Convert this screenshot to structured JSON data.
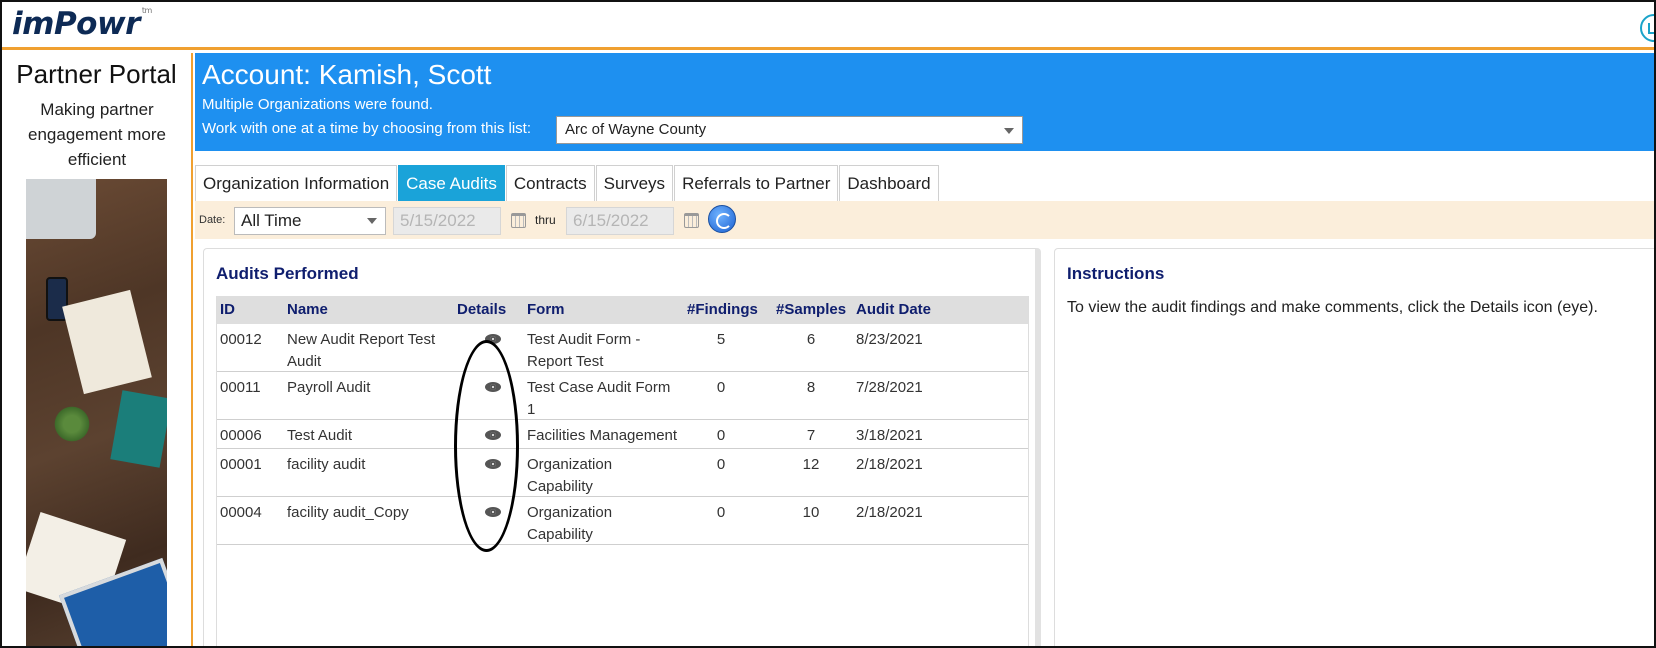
{
  "app": {
    "logo_prefix": "im",
    "logo_suffix": "Powr",
    "logo_tm": "tm"
  },
  "sidebar": {
    "title": "Partner Portal",
    "subtitle": "Making partner engagement more efficient"
  },
  "account": {
    "title": "Account: Kamish, Scott",
    "line1": "Multiple Organizations were found.",
    "line2": "Work with one at a time by choosing from this list:",
    "selected_org": "Arc of Wayne County"
  },
  "tabs": [
    {
      "label": "Organization Information",
      "active": false
    },
    {
      "label": "Case Audits",
      "active": true
    },
    {
      "label": "Contracts",
      "active": false
    },
    {
      "label": "Surveys",
      "active": false
    },
    {
      "label": "Referrals to Partner",
      "active": false
    },
    {
      "label": "Dashboard",
      "active": false
    }
  ],
  "date_filter": {
    "label": "Date:",
    "range": "All Time",
    "from_placeholder": "5/15/2022",
    "thru_label": "thru",
    "to_placeholder": "6/15/2022"
  },
  "audits": {
    "title": "Audits Performed",
    "columns": [
      "ID",
      "Name",
      "Details",
      "Form",
      "#Findings",
      "#Samples",
      "Audit Date"
    ],
    "rows": [
      {
        "id": "00012",
        "name": "New Audit Report Test Audit",
        "form": "Test Audit Form - Report Test",
        "findings": "5",
        "samples": "6",
        "date": "8/23/2021"
      },
      {
        "id": "00011",
        "name": "Payroll Audit",
        "form": "Test Case Audit Form 1",
        "findings": "0",
        "samples": "8",
        "date": "7/28/2021"
      },
      {
        "id": "00006",
        "name": "Test Audit",
        "form": "Facilities Management",
        "findings": "0",
        "samples": "7",
        "date": "3/18/2021"
      },
      {
        "id": "00001",
        "name": "facility audit",
        "form": "Organization Capability",
        "findings": "0",
        "samples": "12",
        "date": "2/18/2021"
      },
      {
        "id": "00004",
        "name": "facility audit_Copy",
        "form": "Organization Capability",
        "findings": "0",
        "samples": "10",
        "date": "2/18/2021"
      }
    ]
  },
  "instructions": {
    "title": "Instructions",
    "text": "To view the audit findings and make comments, click the Details icon (eye)."
  },
  "colors": {
    "header_blue": "#1e90f0",
    "active_tab": "#1aa3d9",
    "accent_orange": "#f0a030",
    "title_navy": "#0f1e6e"
  }
}
